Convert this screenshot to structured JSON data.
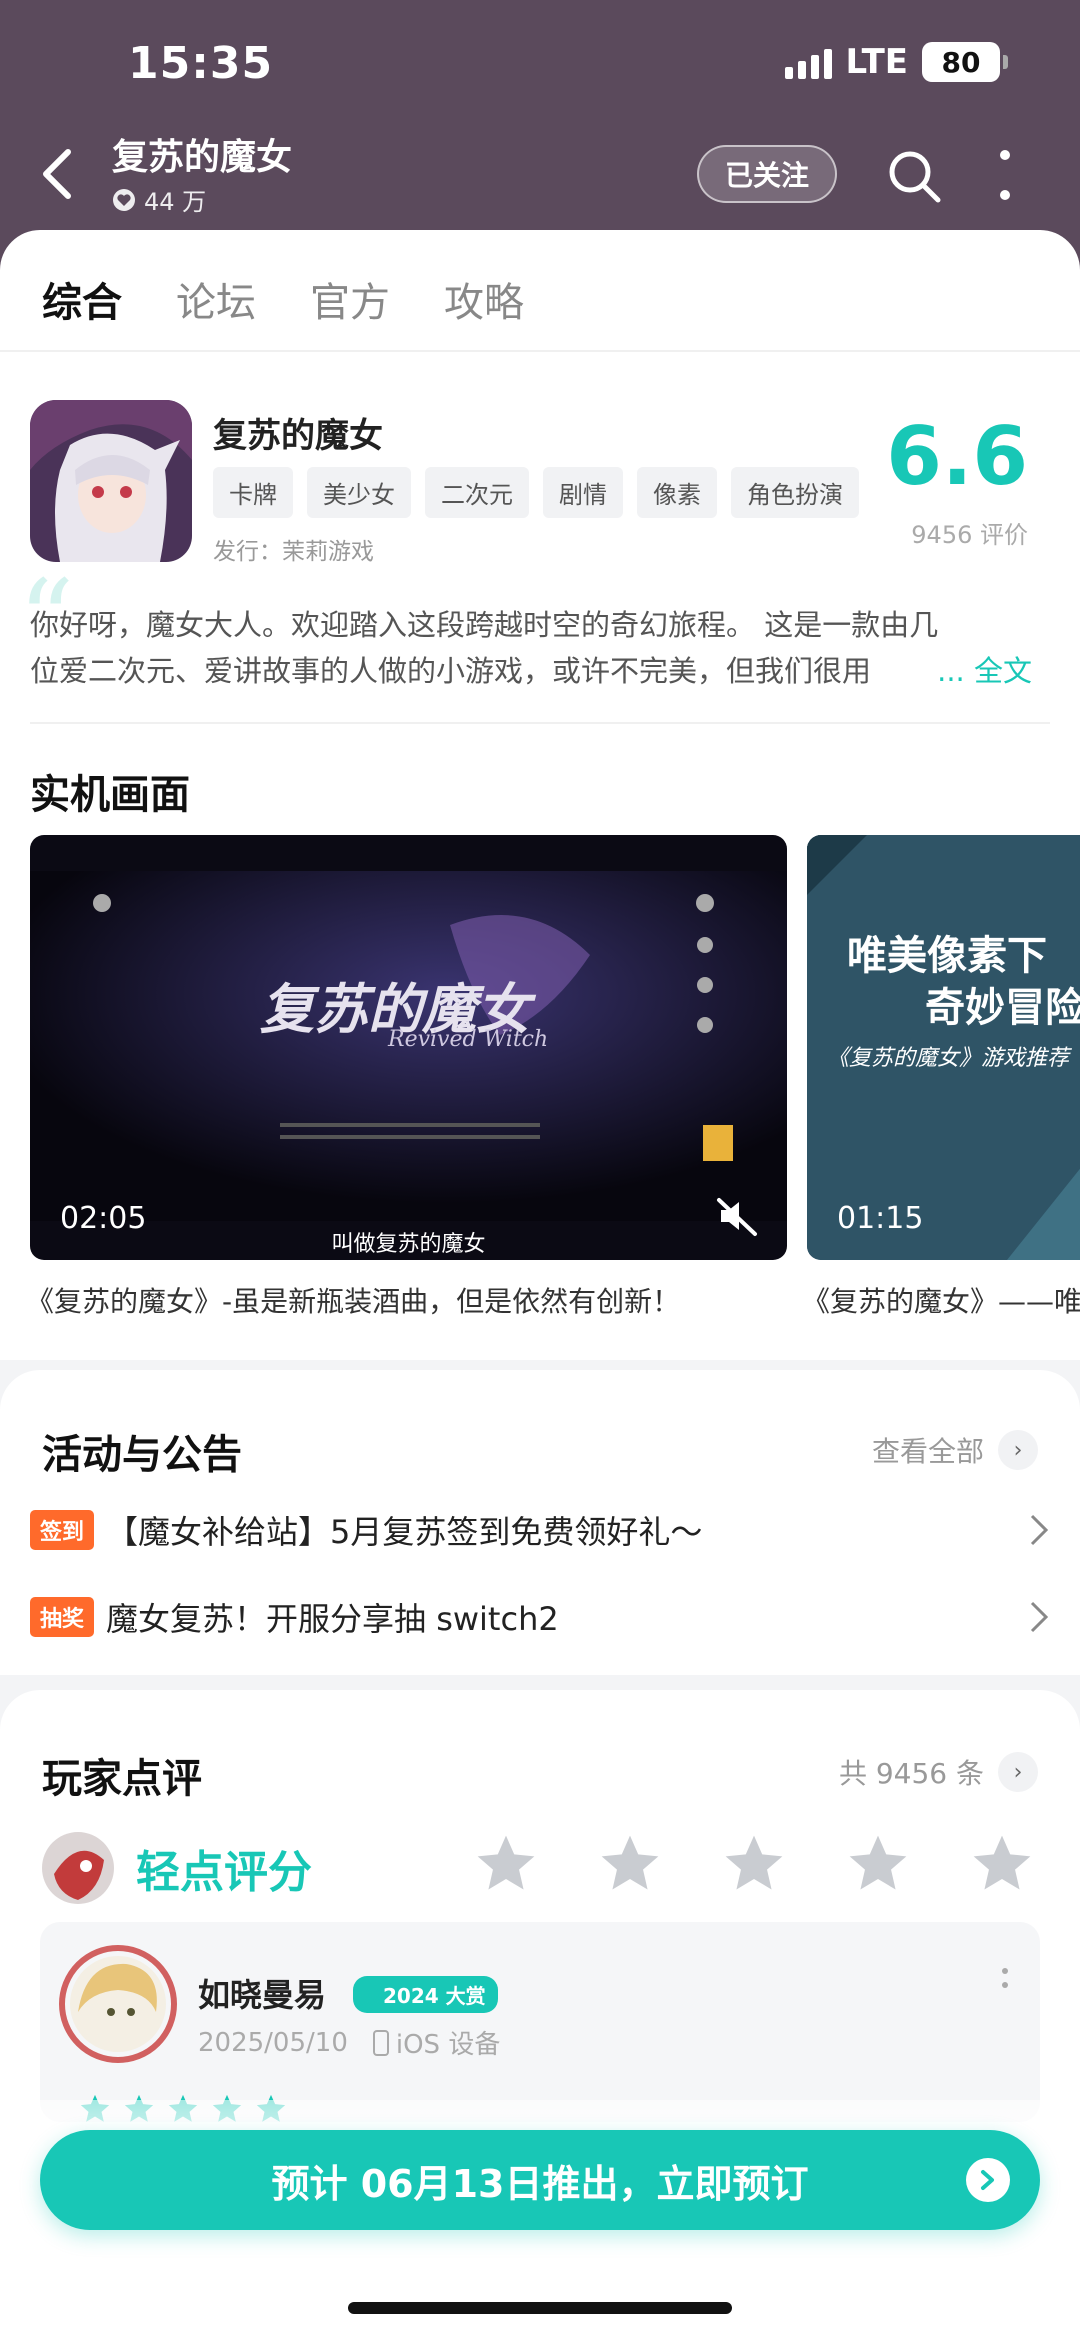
{
  "status_bar": {
    "time": "15:35",
    "network": "LTE",
    "battery": "80"
  },
  "header": {
    "title": "复苏的魔女",
    "fans": "44 万",
    "follow_label": "已关注"
  },
  "tabs": [
    {
      "label": "综合",
      "active": true
    },
    {
      "label": "论坛",
      "active": false
    },
    {
      "label": "官方",
      "active": false
    },
    {
      "label": "攻略",
      "active": false
    }
  ],
  "app": {
    "name": "复苏的魔女",
    "tags": [
      "卡牌",
      "美少女",
      "二次元",
      "剧情",
      "像素",
      "角色扮演"
    ],
    "publisher": "发行：茉莉游戏",
    "score": "6.6",
    "score_count": "9456 评价",
    "description_lines": [
      "你好呀，魔女大人。欢迎踏入这段跨越时空的奇幻旅程。    这是一款由几",
      "位爱二次元、爱讲故事的人做的小游戏，或许不完美，但我们很用"
    ],
    "fulltext_label": "... 全文"
  },
  "screenshots": {
    "heading": "实机画面",
    "videos": [
      {
        "duration": "02:05",
        "subtitle": "叫做复苏的魔女",
        "logo_cn": "复苏的魔女",
        "logo_en": "Revived Witch",
        "caption": "《复苏的魔女》-虽是新瓶装酒曲，但是依然有创新！"
      },
      {
        "duration": "01:15",
        "overlay_line1": "唯美像素下",
        "overlay_line2": "奇妙冒险",
        "overlay_line3": "《复苏的魔女》游戏推荐",
        "caption": "《复苏的魔女》——唯"
      }
    ]
  },
  "activities": {
    "heading": "活动与公告",
    "see_all": "查看全部",
    "items": [
      {
        "badge": "签到",
        "text": "【魔女补给站】5月复苏签到免费领好礼～"
      },
      {
        "badge": "抽奖",
        "text": "魔女复苏！开服分享抽 switch2"
      }
    ]
  },
  "reviews": {
    "heading": "玩家点评",
    "total": "共 9456 条",
    "rate_label": "轻点评分",
    "first_review": {
      "name": "如晓曼易",
      "award": "2024 大赏",
      "date": "2025/05/10",
      "device": "iOS 设备"
    }
  },
  "cta": {
    "label": "预计 06月13日推出，立即预订"
  },
  "colors": {
    "accent": "#18c7b6",
    "header_bg": "#5b4a5c",
    "badge": "#ff6a2b"
  }
}
